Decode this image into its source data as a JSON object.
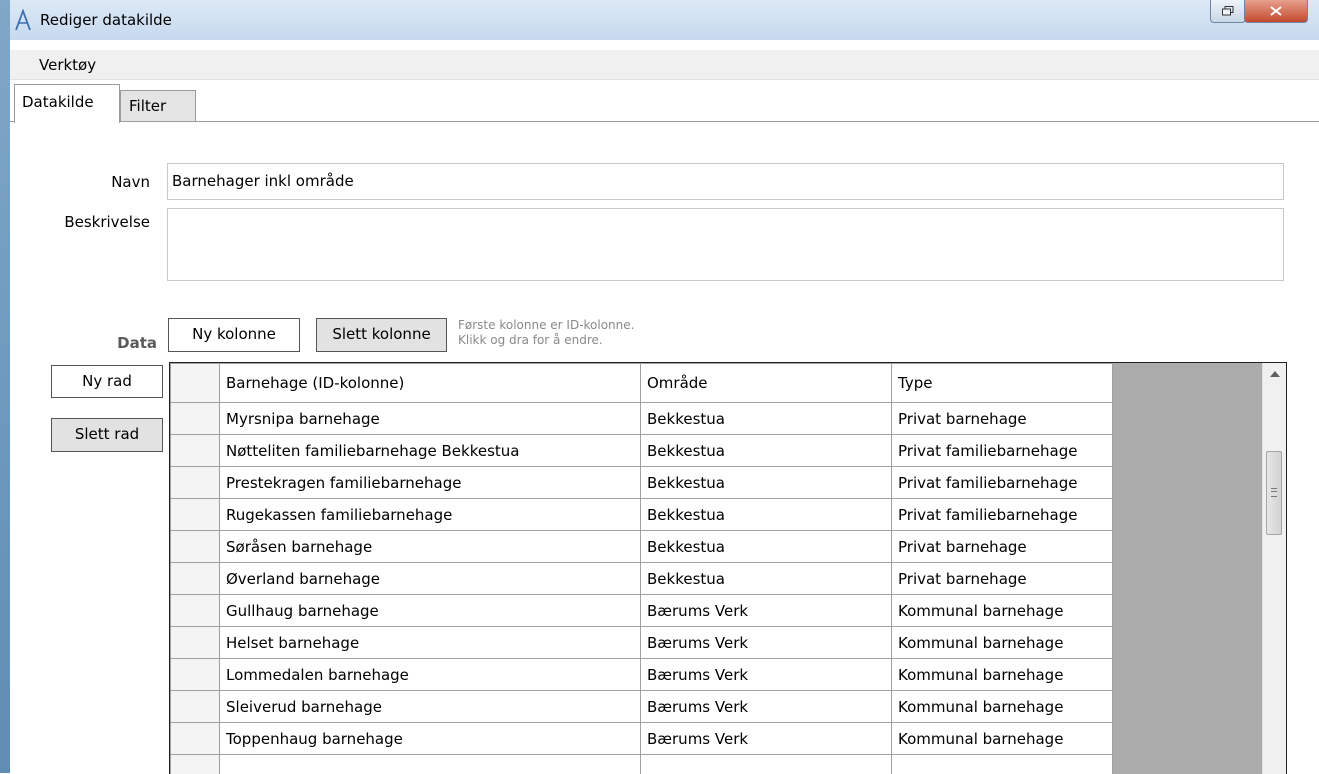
{
  "window": {
    "title": "Rediger datakilde"
  },
  "menu": {
    "items": [
      "Verktøy"
    ]
  },
  "tabs": [
    {
      "label": "Datakilde",
      "active": true
    },
    {
      "label": "Filter",
      "active": false
    }
  ],
  "form": {
    "navn_label": "Navn",
    "navn_value": "Barnehager inkl område",
    "beskrivelse_label": "Beskrivelse",
    "beskrivelse_value": ""
  },
  "data_section": {
    "label": "Data",
    "ny_kolonne": "Ny kolonne",
    "slett_kolonne": "Slett kolonne",
    "ny_rad": "Ny rad",
    "slett_rad": "Slett rad",
    "hint_line1": "Første kolonne er ID-kolonne.",
    "hint_line2": "Klikk og dra for å endre."
  },
  "grid": {
    "columns": [
      "Barnehage (ID-kolonne)",
      "Område",
      "Type"
    ],
    "rows": [
      [
        "Myrsnipa barnehage",
        "Bekkestua",
        "Privat barnehage"
      ],
      [
        "Nøtteliten familiebarnehage Bekkestua",
        "Bekkestua",
        "Privat familiebarnehage"
      ],
      [
        "Prestekragen familiebarnehage",
        "Bekkestua",
        "Privat familiebarnehage"
      ],
      [
        "Rugekassen familiebarnehage",
        "Bekkestua",
        "Privat familiebarnehage"
      ],
      [
        "Søråsen barnehage",
        "Bekkestua",
        "Privat barnehage"
      ],
      [
        "Øverland barnehage",
        "Bekkestua",
        "Privat barnehage"
      ],
      [
        "Gullhaug barnehage",
        "Bærums Verk",
        "Kommunal barnehage"
      ],
      [
        "Helset barnehage",
        "Bærums Verk",
        "Kommunal barnehage"
      ],
      [
        "Lommedalen  barnehage",
        "Bærums Verk",
        "Kommunal barnehage"
      ],
      [
        "Sleiverud barnehage",
        "Bærums Verk",
        "Kommunal barnehage"
      ],
      [
        "Toppenhaug barnehage",
        "Bærums Verk",
        "Kommunal barnehage"
      ],
      [
        "",
        "",
        ""
      ]
    ]
  },
  "icons": {
    "app": "app-logo-icon",
    "restore": "restore-window-icon",
    "close": "close-window-icon",
    "scroll_up": "scroll-up-arrow-icon",
    "scroll_grip": "scroll-grip-icon"
  },
  "colors": {
    "titlebar": "#c6d9ee",
    "close_button": "#c44a2f",
    "grid_empty": "#ababab"
  }
}
